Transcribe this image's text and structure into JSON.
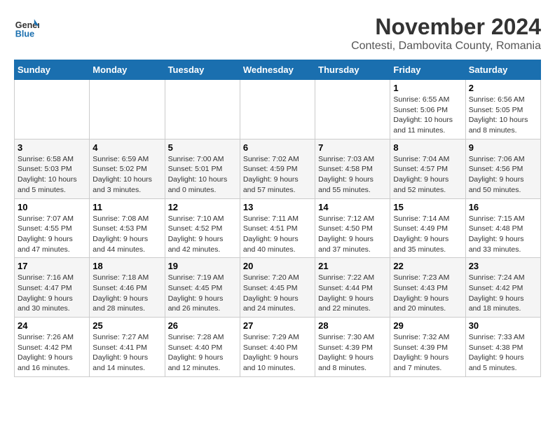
{
  "logo": {
    "line1": "General",
    "line2": "Blue"
  },
  "title": "November 2024",
  "location": "Contesti, Dambovita County, Romania",
  "weekdays": [
    "Sunday",
    "Monday",
    "Tuesday",
    "Wednesday",
    "Thursday",
    "Friday",
    "Saturday"
  ],
  "weeks": [
    [
      {
        "day": "",
        "info": ""
      },
      {
        "day": "",
        "info": ""
      },
      {
        "day": "",
        "info": ""
      },
      {
        "day": "",
        "info": ""
      },
      {
        "day": "",
        "info": ""
      },
      {
        "day": "1",
        "info": "Sunrise: 6:55 AM\nSunset: 5:06 PM\nDaylight: 10 hours and 11 minutes."
      },
      {
        "day": "2",
        "info": "Sunrise: 6:56 AM\nSunset: 5:05 PM\nDaylight: 10 hours and 8 minutes."
      }
    ],
    [
      {
        "day": "3",
        "info": "Sunrise: 6:58 AM\nSunset: 5:03 PM\nDaylight: 10 hours and 5 minutes."
      },
      {
        "day": "4",
        "info": "Sunrise: 6:59 AM\nSunset: 5:02 PM\nDaylight: 10 hours and 3 minutes."
      },
      {
        "day": "5",
        "info": "Sunrise: 7:00 AM\nSunset: 5:01 PM\nDaylight: 10 hours and 0 minutes."
      },
      {
        "day": "6",
        "info": "Sunrise: 7:02 AM\nSunset: 4:59 PM\nDaylight: 9 hours and 57 minutes."
      },
      {
        "day": "7",
        "info": "Sunrise: 7:03 AM\nSunset: 4:58 PM\nDaylight: 9 hours and 55 minutes."
      },
      {
        "day": "8",
        "info": "Sunrise: 7:04 AM\nSunset: 4:57 PM\nDaylight: 9 hours and 52 minutes."
      },
      {
        "day": "9",
        "info": "Sunrise: 7:06 AM\nSunset: 4:56 PM\nDaylight: 9 hours and 50 minutes."
      }
    ],
    [
      {
        "day": "10",
        "info": "Sunrise: 7:07 AM\nSunset: 4:55 PM\nDaylight: 9 hours and 47 minutes."
      },
      {
        "day": "11",
        "info": "Sunrise: 7:08 AM\nSunset: 4:53 PM\nDaylight: 9 hours and 44 minutes."
      },
      {
        "day": "12",
        "info": "Sunrise: 7:10 AM\nSunset: 4:52 PM\nDaylight: 9 hours and 42 minutes."
      },
      {
        "day": "13",
        "info": "Sunrise: 7:11 AM\nSunset: 4:51 PM\nDaylight: 9 hours and 40 minutes."
      },
      {
        "day": "14",
        "info": "Sunrise: 7:12 AM\nSunset: 4:50 PM\nDaylight: 9 hours and 37 minutes."
      },
      {
        "day": "15",
        "info": "Sunrise: 7:14 AM\nSunset: 4:49 PM\nDaylight: 9 hours and 35 minutes."
      },
      {
        "day": "16",
        "info": "Sunrise: 7:15 AM\nSunset: 4:48 PM\nDaylight: 9 hours and 33 minutes."
      }
    ],
    [
      {
        "day": "17",
        "info": "Sunrise: 7:16 AM\nSunset: 4:47 PM\nDaylight: 9 hours and 30 minutes."
      },
      {
        "day": "18",
        "info": "Sunrise: 7:18 AM\nSunset: 4:46 PM\nDaylight: 9 hours and 28 minutes."
      },
      {
        "day": "19",
        "info": "Sunrise: 7:19 AM\nSunset: 4:45 PM\nDaylight: 9 hours and 26 minutes."
      },
      {
        "day": "20",
        "info": "Sunrise: 7:20 AM\nSunset: 4:45 PM\nDaylight: 9 hours and 24 minutes."
      },
      {
        "day": "21",
        "info": "Sunrise: 7:22 AM\nSunset: 4:44 PM\nDaylight: 9 hours and 22 minutes."
      },
      {
        "day": "22",
        "info": "Sunrise: 7:23 AM\nSunset: 4:43 PM\nDaylight: 9 hours and 20 minutes."
      },
      {
        "day": "23",
        "info": "Sunrise: 7:24 AM\nSunset: 4:42 PM\nDaylight: 9 hours and 18 minutes."
      }
    ],
    [
      {
        "day": "24",
        "info": "Sunrise: 7:26 AM\nSunset: 4:42 PM\nDaylight: 9 hours and 16 minutes."
      },
      {
        "day": "25",
        "info": "Sunrise: 7:27 AM\nSunset: 4:41 PM\nDaylight: 9 hours and 14 minutes."
      },
      {
        "day": "26",
        "info": "Sunrise: 7:28 AM\nSunset: 4:40 PM\nDaylight: 9 hours and 12 minutes."
      },
      {
        "day": "27",
        "info": "Sunrise: 7:29 AM\nSunset: 4:40 PM\nDaylight: 9 hours and 10 minutes."
      },
      {
        "day": "28",
        "info": "Sunrise: 7:30 AM\nSunset: 4:39 PM\nDaylight: 9 hours and 8 minutes."
      },
      {
        "day": "29",
        "info": "Sunrise: 7:32 AM\nSunset: 4:39 PM\nDaylight: 9 hours and 7 minutes."
      },
      {
        "day": "30",
        "info": "Sunrise: 7:33 AM\nSunset: 4:38 PM\nDaylight: 9 hours and 5 minutes."
      }
    ]
  ]
}
